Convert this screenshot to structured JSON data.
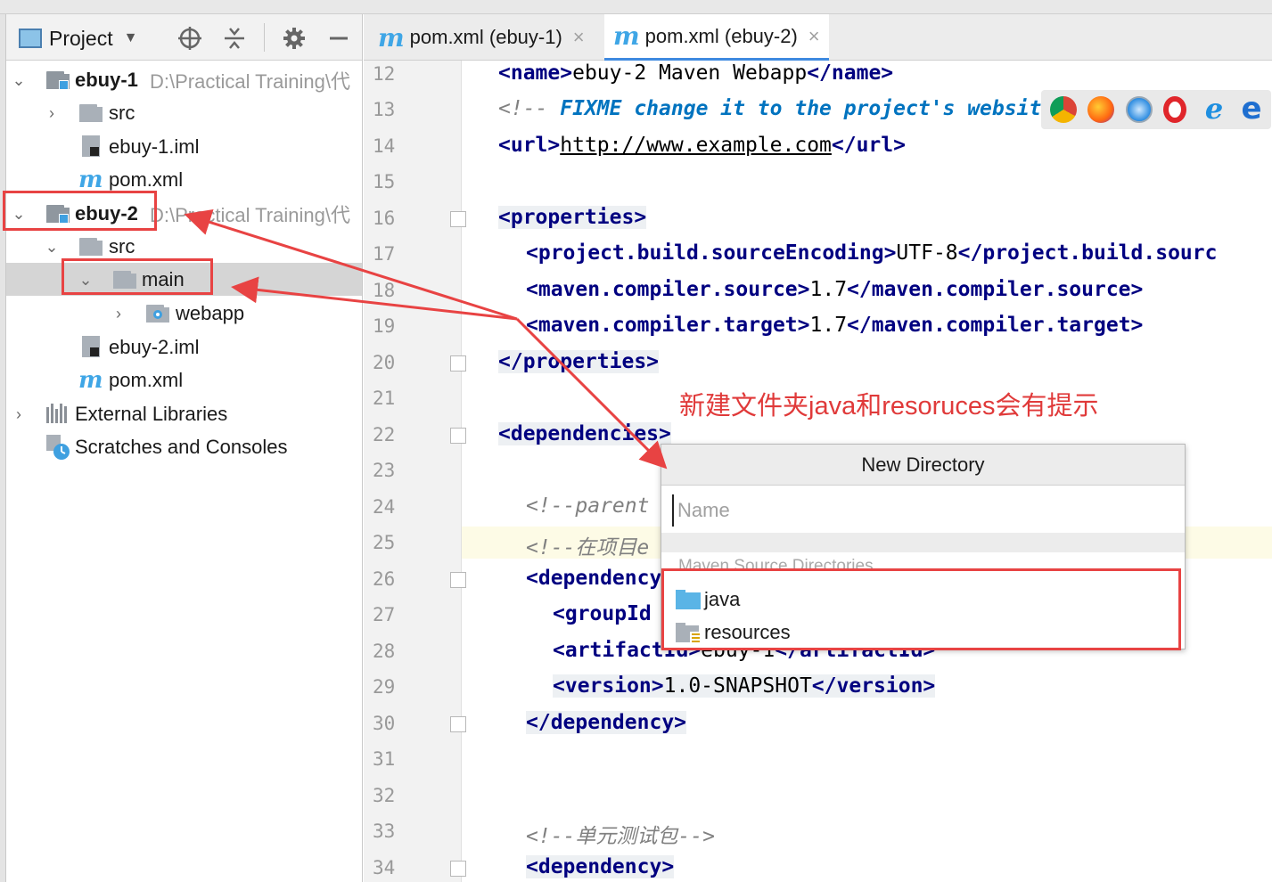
{
  "project_panel": {
    "selector_label": "Project",
    "tree": [
      {
        "label": "ebuy-1",
        "path": "D:\\Practical Training\\代",
        "bold": true
      },
      {
        "label": "src"
      },
      {
        "label": "ebuy-1.iml"
      },
      {
        "label": "pom.xml"
      },
      {
        "label": "ebuy-2",
        "path": "D:\\Practical Training\\代",
        "bold": true
      },
      {
        "label": "src"
      },
      {
        "label": "main"
      },
      {
        "label": "webapp"
      },
      {
        "label": "ebuy-2.iml"
      },
      {
        "label": "pom.xml"
      },
      {
        "label": "External Libraries"
      },
      {
        "label": "Scratches and Consoles"
      }
    ]
  },
  "editor": {
    "tabs": [
      {
        "icon": "m",
        "label": "pom.xml (ebuy-1)",
        "close": "×"
      },
      {
        "icon": "m",
        "label": "pom.xml (ebuy-2)",
        "close": "×"
      }
    ],
    "line_numbers": [
      "12",
      "13",
      "14",
      "15",
      "16",
      "17",
      "18",
      "19",
      "20",
      "21",
      "22",
      "23",
      "24",
      "25",
      "26",
      "27",
      "28",
      "29",
      "30",
      "31",
      "32",
      "33",
      "34"
    ],
    "code": {
      "l12": {
        "open": "<name>",
        "text": "ebuy-2 Maven Webapp",
        "close": "</name>"
      },
      "l13": {
        "prefix": "<!-- ",
        "todo": "FIXME change it to the project's webs",
        "rest": "ite -->"
      },
      "l14": {
        "open": "<url>",
        "text": "http://www.example.com",
        "close": "</url>"
      },
      "l16": "<properties>",
      "l17": {
        "open": "<project.build.sourceEncoding>",
        "text": "UTF-8",
        "close": "</project.build.sourc"
      },
      "l18": {
        "open": "<maven.compiler.source>",
        "text": "1.7",
        "close": "</maven.compiler.source>"
      },
      "l19": {
        "open": "<maven.compiler.target>",
        "text": "1.7",
        "close": "</maven.compiler.target>"
      },
      "l20": "</properties>",
      "l22": "<dependencies>",
      "l24": "<!--parent ",
      "l25": "<!--在项目e",
      "l26": "<dependency",
      "l27": "<groupId",
      "l28": {
        "open": "<artifactId>",
        "text": "ebuy-1",
        "close": "</artifactId>"
      },
      "l29": {
        "open": "<version>",
        "text": "1.0-SNAPSHOT",
        "close": "</version>"
      },
      "l30": "</dependency>",
      "l33": "<!--单元测试包-->",
      "l34": "<dependency>"
    }
  },
  "annotation": "新建文件夹java和resoruces会有提示",
  "popup": {
    "title": "New Directory",
    "placeholder": "Name",
    "section": "Maven Source Directories",
    "items": [
      {
        "label": "java",
        "icon": "folder-icon"
      },
      {
        "label": "resources",
        "icon": "resources-folder-icon"
      }
    ]
  },
  "browser_icons": [
    "chrome-icon",
    "firefox-icon",
    "safari-icon",
    "opera-icon",
    "ie-icon",
    "edge-icon"
  ],
  "colors": {
    "annotation_red": "#e84343",
    "tag_blue": "#000080",
    "maven_blue": "#3fa6e6"
  }
}
